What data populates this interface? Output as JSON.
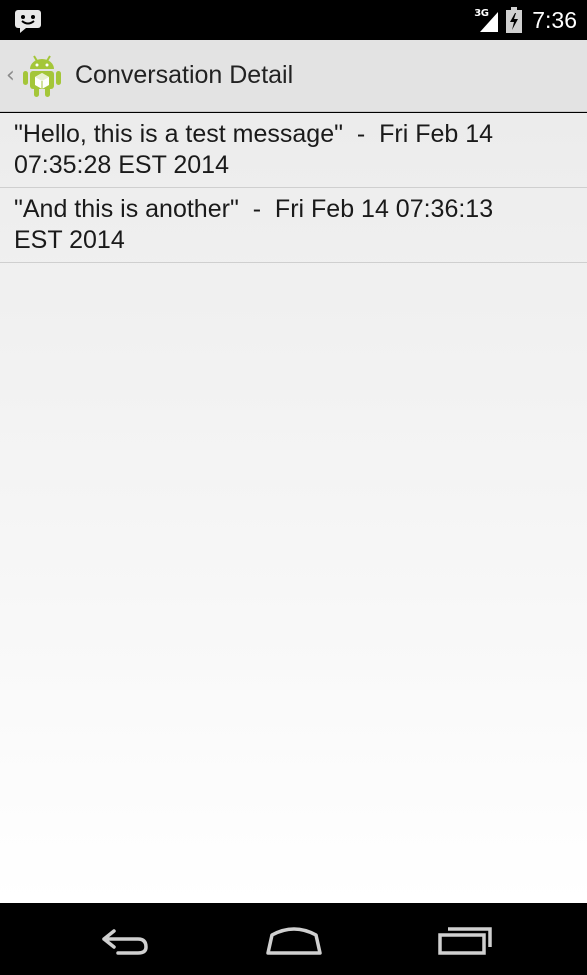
{
  "status_bar": {
    "network_type": "3G",
    "time": "7:36",
    "icons": [
      "message-notification-icon",
      "signal-icon",
      "battery-icon"
    ]
  },
  "action_bar": {
    "title": "Conversation Detail",
    "icons": [
      "up-chevron-icon",
      "android-app-icon"
    ]
  },
  "messages": [
    {
      "text": "\"Hello, this is a test message\"  -  Fri Feb 14\n07:35:28 EST 2014"
    },
    {
      "text": "\"And this is another\"  -  Fri Feb 14 07:36:13\nEST 2014"
    }
  ],
  "nav_bar": {
    "icons": [
      "back-icon",
      "home-icon",
      "recent-apps-icon"
    ]
  },
  "colors": {
    "action_bar_bg": "#e3e3e3",
    "android_green": "#a4c639",
    "divider": "#cfcfcf"
  }
}
